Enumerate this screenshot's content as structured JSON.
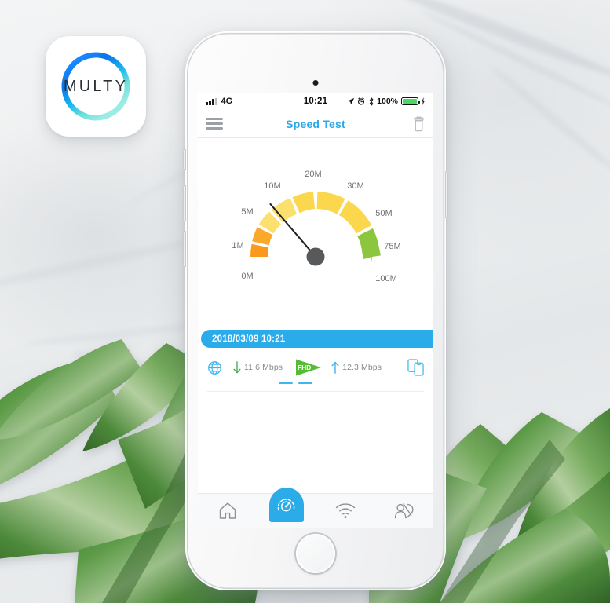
{
  "app_icon": {
    "name": "multy-app-icon",
    "brand_text": "MULTY",
    "ring_color_start": "#0a84ff",
    "ring_color_end": "#7fe3d8"
  },
  "device": {
    "name": "white-iphone"
  },
  "screen": {
    "status_bar": {
      "signal_icon": "signal-bars-icon",
      "carrier": "4G",
      "time": "10:21",
      "location_icon": "location-arrow-icon",
      "alarm_icon": "alarm-clock-icon",
      "bluetooth_icon": "bluetooth-icon",
      "battery_percent": "100%",
      "battery_icon": "battery-full-icon",
      "charging_icon": "lightning-bolt-icon"
    },
    "nav_bar": {
      "menu_icon": "hamburger-menu-icon",
      "title": "Speed Test",
      "delete_icon": "trash-icon",
      "title_color": "#2ba8e8"
    },
    "gauge": {
      "labels": [
        "0M",
        "1M",
        "5M",
        "10M",
        "20M",
        "30M",
        "50M",
        "75M",
        "100M"
      ],
      "needle_value_label": "10M",
      "colors": {
        "orange": "#F99A1C",
        "orange_light": "#FBA82B",
        "yellow": "#FBD74E",
        "yellow_light": "#FCE06E",
        "green": "#8CC63F",
        "hub": "#58595B",
        "needle": "#231F20",
        "label": "#6f7276"
      }
    },
    "result": {
      "timestamp": "2018/03/09 10:21",
      "timestamp_bg": "#2aaceb",
      "globe_icon": "globe-icon",
      "download_icon": "arrow-down-icon",
      "download": "11.6 Mbps",
      "quality_badge": "FHD",
      "quality_badge_icon": "play-triangle-icon",
      "quality_badge_color": "#55bd33",
      "upload_icon": "arrow-up-icon",
      "upload": "12.3 Mbps",
      "devices_icon": "devices-icon"
    },
    "tab_bar": {
      "tabs": [
        {
          "icon": "home-icon",
          "name": "tab-home",
          "active": false
        },
        {
          "icon": "speedometer-icon",
          "name": "tab-speedtest",
          "active": true
        },
        {
          "icon": "wifi-icon",
          "name": "tab-wifi",
          "active": false
        },
        {
          "icon": "guest-user-icon",
          "name": "tab-guest",
          "active": false
        }
      ],
      "active_color": "#2bace9",
      "inactive_color": "#8c9094"
    }
  },
  "chart_data": {
    "type": "gauge",
    "title": "Speed Test",
    "categories": [
      "0M",
      "1M",
      "5M",
      "10M",
      "20M",
      "30M",
      "50M",
      "75M",
      "100M"
    ],
    "values": [
      0,
      1,
      5,
      10,
      20,
      30,
      50,
      75,
      100
    ],
    "needle_value": 11.6,
    "unit": "Mbps",
    "segment_colors": [
      "#F99A1C",
      "#FBA82B",
      "#FCE06E",
      "#FBD74E",
      "#FBD74E",
      "#FBD74E",
      "#8CC63F",
      "#8CC63F"
    ],
    "download_mbps": 11.6,
    "upload_mbps": 12.3,
    "ylim": [
      0,
      100
    ],
    "grid": false,
    "legend": "none"
  }
}
